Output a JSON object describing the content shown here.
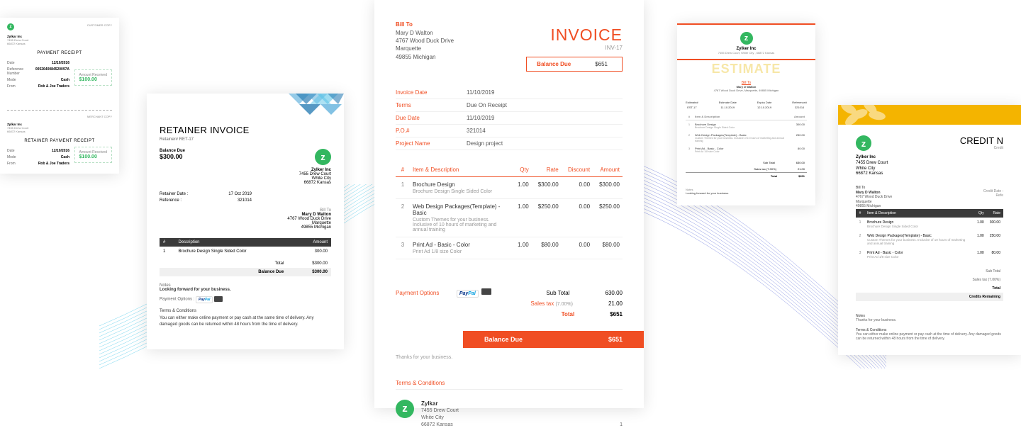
{
  "receipt": {
    "customer_copy": "CUSTOMER COPY",
    "merchant_copy": "MERCHANT COPY",
    "company": "Zylkar Inc",
    "addr1": "7455 Drew Court",
    "addr2": "66872 Kansas",
    "title1": "PAYMENT RECEIPT",
    "title2": "RETAINER PAYMENT RECEIPT",
    "rows": {
      "date_lbl": "Date",
      "date_val": "12/10/2016",
      "ref_lbl": "Reference Number",
      "ref_val": "0052640084520097A",
      "mode_lbl": "Mode",
      "mode_val": "Cash",
      "from_lbl": "From",
      "from_val": "Rob & Joe Traders"
    },
    "amt_lbl": "Amount Received",
    "amt_val": "$100.00"
  },
  "retainer": {
    "title": "RETAINER INVOICE",
    "ret_no": "Retainer# RET-17",
    "bd_lbl": "Balance Due",
    "bd_val": "$300.00",
    "company": "Zylker Inc",
    "co_addr": [
      "7455 Drew Court",
      "White City",
      "66872 Kansas"
    ],
    "date_lbl": "Retainer Date :",
    "date_val": "17 Oct 2019",
    "ref_lbl": "Reference :",
    "ref_val": "321014",
    "billto_lbl": "Bill To",
    "billto": [
      "Mary D Walton",
      "4767 Wood Duck Drive",
      "Marquette",
      "49855 Michigan"
    ],
    "th1": "#",
    "th2": "Description",
    "th3": "Amount",
    "item_no": "1",
    "item_desc": "Brochure Design Single Sided Color",
    "item_amt": "300.00",
    "total_lbl": "Total",
    "total_val": "$300.00",
    "bal_lbl": "Balance Due",
    "bal_val": "$300.00",
    "notes_h": "Notes",
    "notes": "Looking forward for your business.",
    "pay_lbl": "Payment Options :",
    "paypal": "PayPal",
    "tc_h": "Terms & Conditions",
    "tc": "You can either make online payment or pay cash at the same time of delivery. Any damaged goods can be returned within 48 hours from the time of delivery."
  },
  "invoice": {
    "billto_lbl": "Bill To",
    "addr": [
      "Mary D Walton",
      "4767 Wood Duck Drive",
      "Marquette",
      "49855 Michigan"
    ],
    "title": "INVOICE",
    "no": "INV-17",
    "bd_lbl": "Balance Due",
    "bd_val": "$651",
    "meta": [
      {
        "l": "Invoice Date",
        "v": "11/10/2019"
      },
      {
        "l": "Terms",
        "v": "Due On Receipt"
      },
      {
        "l": "Due Date",
        "v": "11/10/2019"
      },
      {
        "l": "P.O.#",
        "v": "321014"
      },
      {
        "l": "Project Name",
        "v": "Design project"
      }
    ],
    "th": [
      "#",
      "Item & Description",
      "Qty",
      "Rate",
      "Discount",
      "Amount"
    ],
    "items": [
      {
        "n": "1",
        "name": "Brochure Design",
        "desc": "Brochure Design Single Sided Color",
        "qty": "1.00",
        "rate": "$300.00",
        "disc": "0.00",
        "amt": "$300.00"
      },
      {
        "n": "2",
        "name": "Web Design Packages(Template) - Basic",
        "desc": "Custom Themes for your business. Inclusive of 10 hours of marketing and annual training",
        "qty": "1.00",
        "rate": "$250.00",
        "disc": "0.00",
        "amt": "$250.00"
      },
      {
        "n": "3",
        "name": "Print Ad - Basic - Color",
        "desc": "Print Ad 1/8 size Color",
        "qty": "1.00",
        "rate": "$80.00",
        "disc": "0.00",
        "amt": "$80.00"
      }
    ],
    "pay_lbl": "Payment Options",
    "paypal": "PayPal",
    "sub_lbl": "Sub Total",
    "sub_val": "630.00",
    "tax_lbl": "Sales tax",
    "tax_pct": "(7.00%)",
    "tax_val": "21.00",
    "tot_lbl": "Total",
    "tot_val": "$651",
    "bal_lbl": "Balance Due",
    "bal_val": "$651",
    "thanks": "Thanks for your business.",
    "tc_h": "Terms & Conditions",
    "co_name": "Zylkar",
    "co_addr": [
      "7455 Drew Court",
      "White City",
      "66872 Kansas"
    ],
    "page": "1"
  },
  "estimate": {
    "co": "Zylker Inc",
    "co_addr": "7455 Drew Court, White City , 66872 Kansas",
    "title": "ESTIMATE",
    "bt_lbl": "Bill To",
    "bt": [
      "Mary D Walton",
      "4767 Wood Duck Drive, Marquette, 49855 Michigan"
    ],
    "meta": [
      {
        "l": "Estimate#",
        "v": "EST-17"
      },
      {
        "l": "Estimate Date",
        "v": "11.10.2019"
      },
      {
        "l": "Expiry Date",
        "v": "12.10.2019"
      },
      {
        "l": "Reference#",
        "v": "321014"
      }
    ],
    "th": [
      "#",
      "Item & Description",
      "Amount"
    ],
    "items": [
      {
        "n": "1",
        "name": "Brochure Design",
        "desc": "Brochure Design Single Sided Color",
        "amt": "300.00"
      },
      {
        "n": "2",
        "name": "Web Design Packages(Template) - Basic",
        "desc": "Custom Themes for your business. Inclusive of 10 hours of marketing and annual training",
        "amt": "250.00"
      },
      {
        "n": "3",
        "name": "Print Ad - Basic - Color",
        "desc": "Print Ad 1/8 size Color",
        "amt": "80.00"
      }
    ],
    "sub_lbl": "Sub Total",
    "sub_val": "630.00",
    "tax_lbl": "Sales tax (7.00%)",
    "tax_val": "21.00",
    "tot_lbl": "Total",
    "tot_val": "$651",
    "notes_h": "Notes",
    "notes": "Looking forward for your business."
  },
  "credit": {
    "title": "CREDIT N",
    "sub": "Credit",
    "co": "Zylker Inc",
    "co_addr": [
      "7455 Drew Court",
      "White City",
      "66872 Kansas"
    ],
    "bt_lbl": "Bill To",
    "bt": [
      "Mary D Walton",
      "4767 Wood Duck Drive",
      "Marquette",
      "49855 Michigan"
    ],
    "cd_lbl": "Credit Date :",
    "ref_lbl": "Refe",
    "th": [
      "#",
      "Item & Description",
      "Qty",
      "Rate"
    ],
    "items": [
      {
        "n": "1",
        "name": "Brochure Design",
        "desc": "Brochure Design Single Sided Color",
        "qty": "1.00",
        "rate": "300.00"
      },
      {
        "n": "2",
        "name": "Web Design Packages(Template) - Basic",
        "desc": "Custom Themes for your business. Inclusive of 10 hours of marketing and annual training",
        "qty": "1.00",
        "rate": "250.00"
      },
      {
        "n": "3",
        "name": "Print Ad - Basic - Color",
        "desc": "Print Ad 1/8 size Color",
        "qty": "1.00",
        "rate": "80.00"
      }
    ],
    "sub_lbl": "Sub Total",
    "tax_lbl": "Sales tax (7.00%)",
    "tot_lbl": "Total",
    "cr_lbl": "Credits Remaining",
    "notes_h": "Notes",
    "notes": "Thanks for your business.",
    "tc_h": "Terms & Conditions",
    "tc": "You can either make online payment or pay cash at the time of delivery. Any damaged goods can be returned within 48 hours from the time of delivery."
  }
}
